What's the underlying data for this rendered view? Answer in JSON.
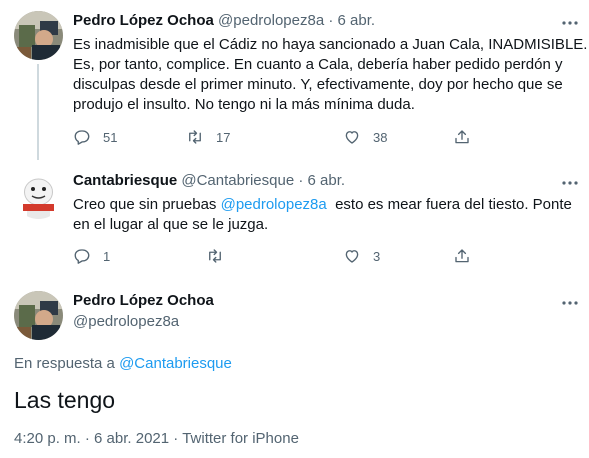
{
  "tweets": [
    {
      "name": "Pedro López Ochoa",
      "handle": "@pedrolopez8a",
      "dot": "·",
      "date": "6 abr.",
      "text_lines": [
        "Es inadmisible que el Cádiz no haya sancionado a Juan Cala, INADMISIBLE.",
        "Es, por tanto, complice. En cuanto a Cala, debería haber pedido perdón y",
        "disculpas desde el primer minuto. Y, efectivamente, doy por hecho que se",
        "produjo el insulto. No tengo ni la más mínima duda."
      ],
      "replies": "51",
      "retweets": "17",
      "likes": "38"
    },
    {
      "name": "Cantabriesque",
      "handle": "@Cantabriesque",
      "dot": "·",
      "date": "6 abr.",
      "text_line1_before": "Creo que sin pruebas ",
      "text_mention": "@pedrolopez8a",
      "text_line1_after": "  esto es mear fuera del tiesto. Ponte",
      "text_line2": "en el lugar al que se le juzga.",
      "replies": "1",
      "retweets": "",
      "likes": "3"
    }
  ],
  "main_tweet": {
    "name": "Pedro López Ochoa",
    "handle": "@pedrolopez8a",
    "reply_prefix": "En respuesta a ",
    "reply_mention": "@Cantabriesque",
    "text": "Las tengo",
    "time": "4:20 p. m.",
    "date": "6 abr. 2021",
    "source": "Twitter for iPhone",
    "sep": "·"
  },
  "icons": {
    "reply": "reply-icon",
    "retweet": "retweet-icon",
    "like": "heart-icon",
    "share": "share-icon",
    "more": "more-dots-icon"
  },
  "colors": {
    "accent": "#1d9bf0",
    "secondary_text": "#536471",
    "primary_text": "#0f1419",
    "thread_line": "#cfd9de"
  }
}
